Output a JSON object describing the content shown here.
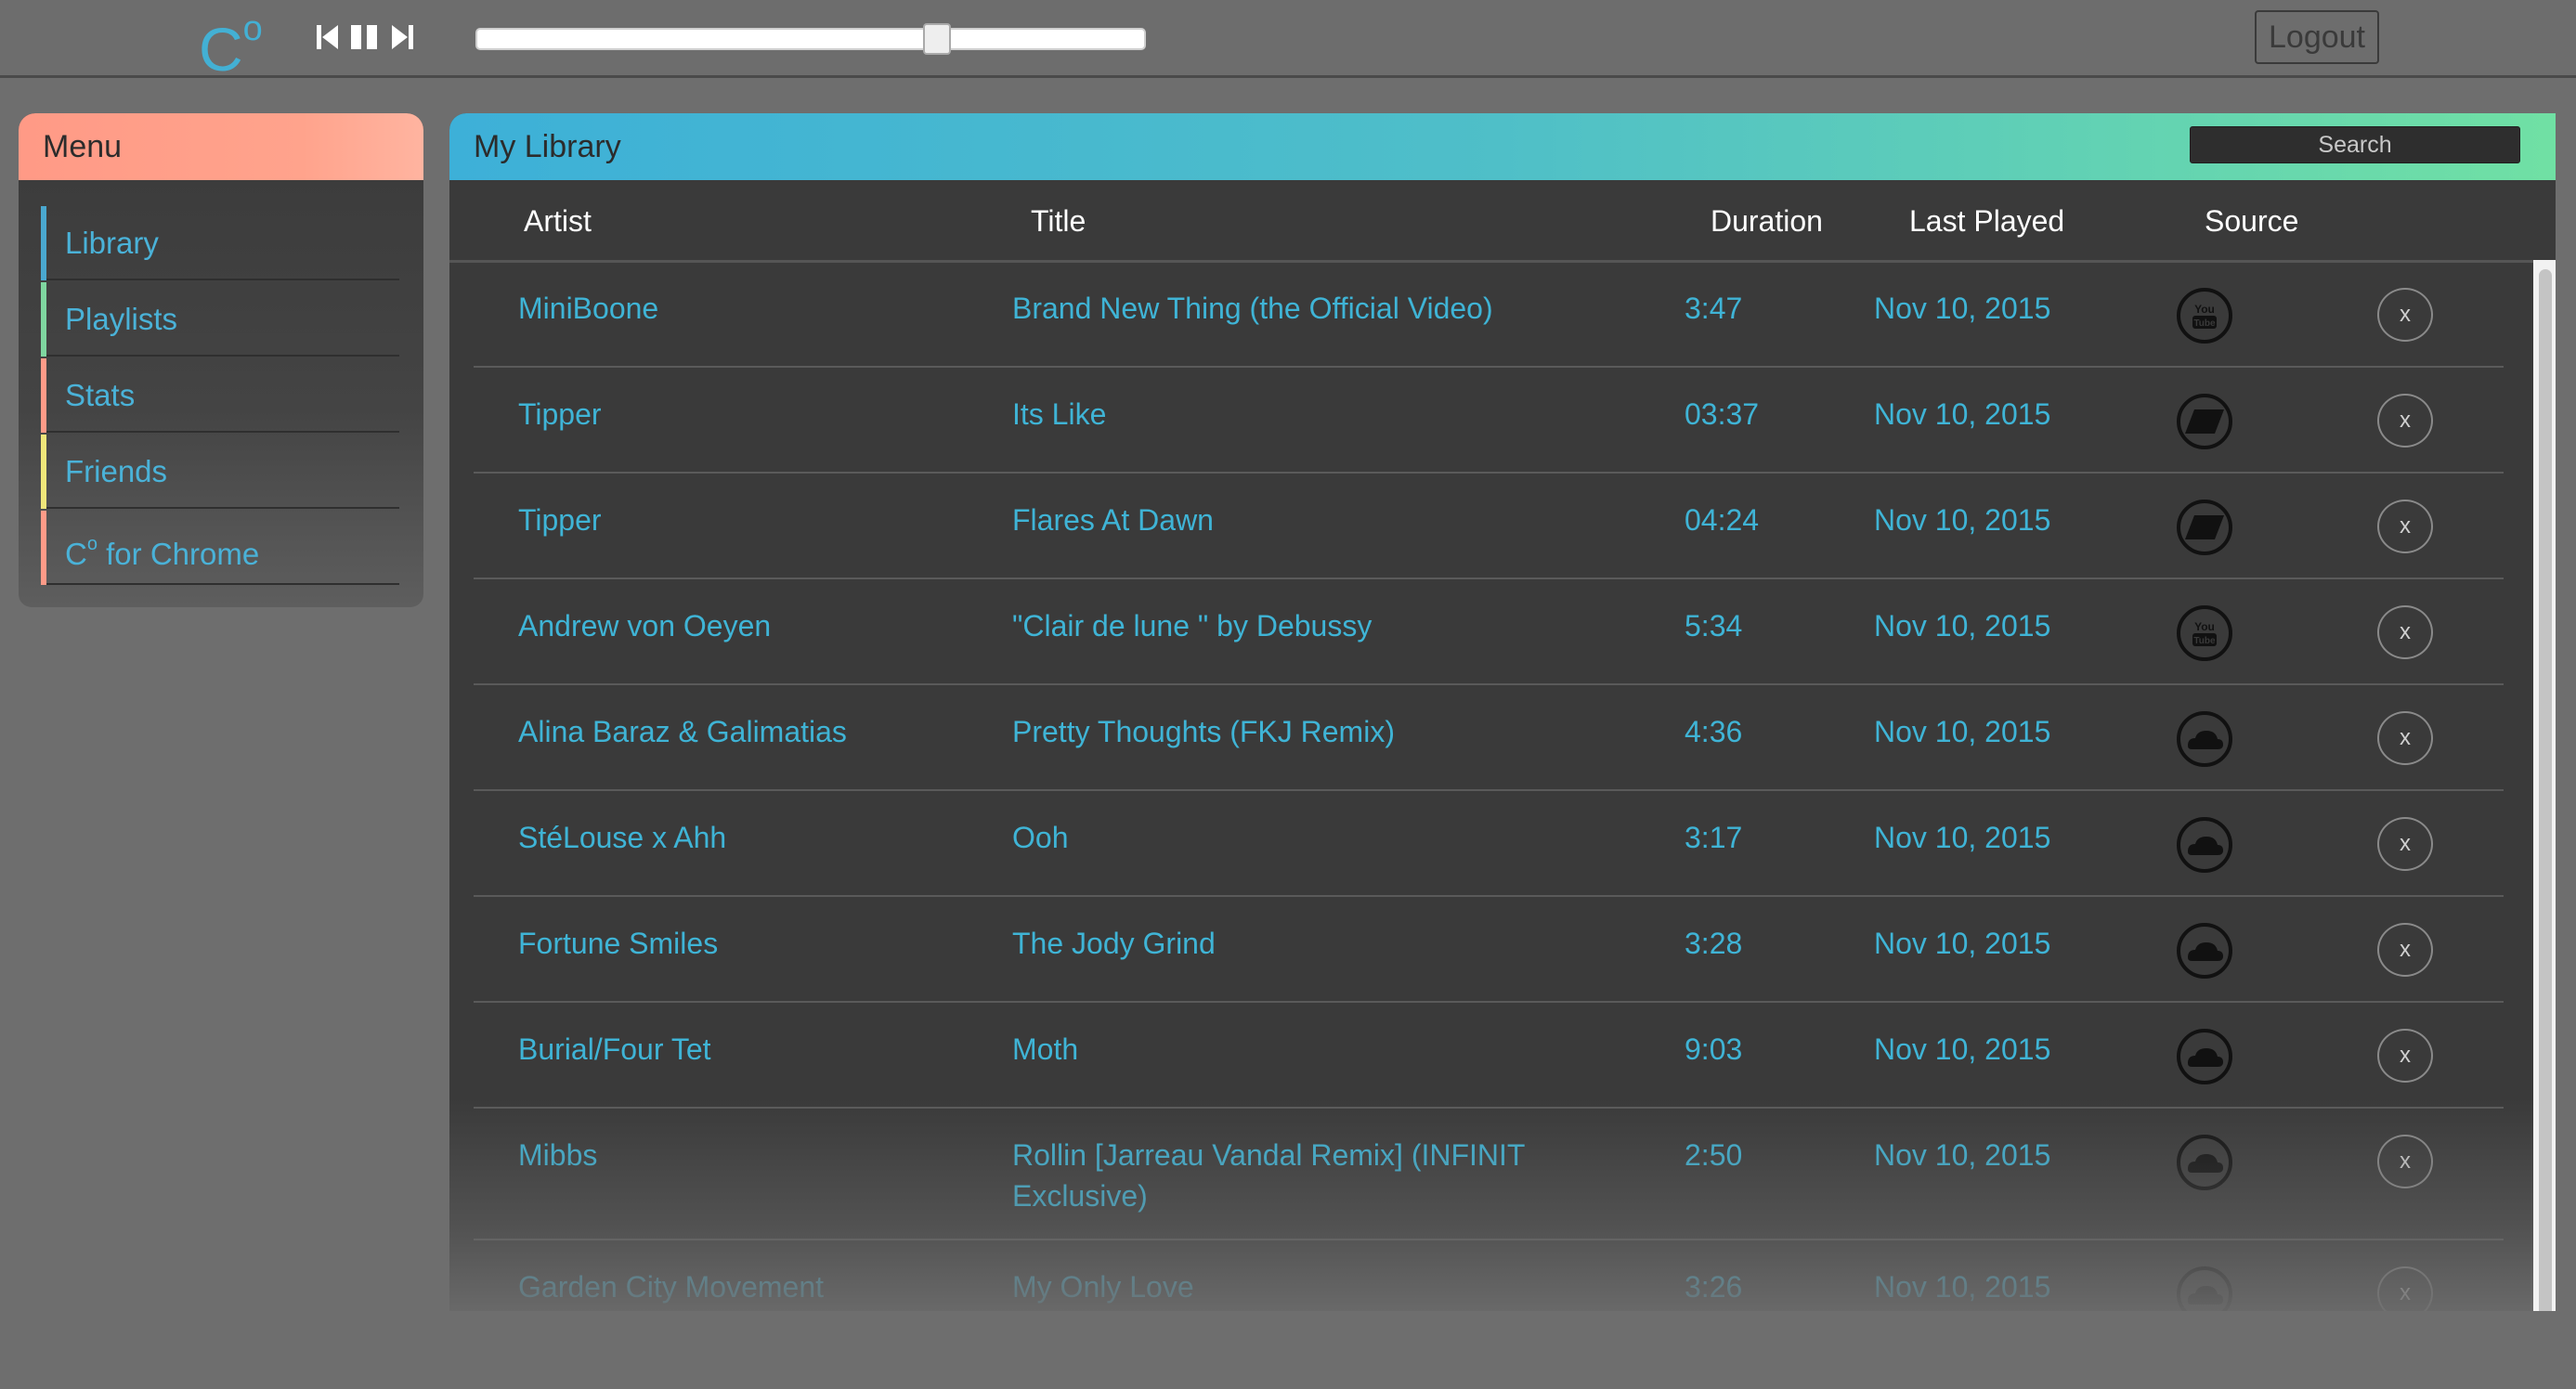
{
  "app": {
    "logo": "C",
    "logo_sup": "o"
  },
  "player": {
    "progress": 0.69
  },
  "header": {
    "logout_label": "Logout"
  },
  "sidebar": {
    "title": "Menu",
    "items": [
      {
        "label": "Library",
        "color": "#4aa8cf"
      },
      {
        "label": "Playlists",
        "color": "#7fd6a0"
      },
      {
        "label": "Stats",
        "color": "#ff9b88"
      },
      {
        "label": "Friends",
        "color": "#f0e77a"
      },
      {
        "label": "C",
        "sup": "o",
        "suffix": " for Chrome",
        "color": "#ff9b88"
      }
    ]
  },
  "library": {
    "title": "My Library",
    "search_placeholder": "Search",
    "columns": {
      "artist": "Artist",
      "title": "Title",
      "duration": "Duration",
      "last_played": "Last Played",
      "source": "Source"
    },
    "delete_label": "x",
    "rows": [
      {
        "artist": "MiniBoone",
        "title": "Brand New Thing (the Official Video)",
        "duration": "3:47",
        "last_played": "Nov 10, 2015",
        "source": "youtube-icon"
      },
      {
        "artist": "Tipper",
        "title": "Its Like",
        "duration": "03:37",
        "last_played": "Nov 10, 2015",
        "source": "bandcamp-icon"
      },
      {
        "artist": "Tipper",
        "title": "Flares At Dawn",
        "duration": "04:24",
        "last_played": "Nov 10, 2015",
        "source": "bandcamp-icon"
      },
      {
        "artist": "Andrew von Oeyen",
        "title": "\"Clair de lune \" by Debussy",
        "duration": "5:34",
        "last_played": "Nov 10, 2015",
        "source": "youtube-icon"
      },
      {
        "artist": "Alina Baraz & Galimatias",
        "title": "Pretty Thoughts (FKJ Remix)",
        "duration": "4:36",
        "last_played": "Nov 10, 2015",
        "source": "soundcloud-icon"
      },
      {
        "artist": "StéLouse x Ahh",
        "title": "Ooh",
        "duration": "3:17",
        "last_played": "Nov 10, 2015",
        "source": "soundcloud-icon"
      },
      {
        "artist": "Fortune Smiles",
        "title": "The Jody Grind",
        "duration": "3:28",
        "last_played": "Nov 10, 2015",
        "source": "soundcloud-icon"
      },
      {
        "artist": "Burial/Four Tet",
        "title": "Moth",
        "duration": "9:03",
        "last_played": "Nov 10, 2015",
        "source": "soundcloud-icon"
      },
      {
        "artist": "Mibbs",
        "title": "Rollin [Jarreau Vandal Remix] (INFINIT Exclusive)",
        "duration": "2:50",
        "last_played": "Nov 10, 2015",
        "source": "soundcloud-icon"
      },
      {
        "artist": "Garden City Movement",
        "title": "My Only Love",
        "duration": "3:26",
        "last_played": "Nov 10, 2015",
        "source": "soundcloud-icon"
      }
    ]
  }
}
